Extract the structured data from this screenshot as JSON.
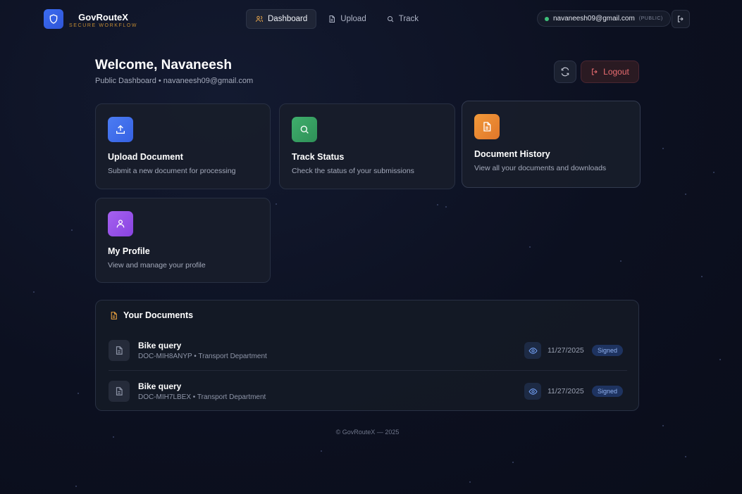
{
  "brand": {
    "name": "GovRouteX",
    "tagline": "SECURE WORKFLOW"
  },
  "nav": {
    "tabs": [
      {
        "label": "Dashboard",
        "icon": "users-icon",
        "active": true
      },
      {
        "label": "Upload",
        "icon": "file-icon",
        "active": false
      },
      {
        "label": "Track",
        "icon": "search-icon",
        "active": false
      }
    ],
    "user_email": "navaneesh09@gmail.com",
    "user_role": "(PUBLIC)"
  },
  "header": {
    "welcome": "Welcome, Navaneesh",
    "subtitle": "Public Dashboard • navaneesh09@gmail.com",
    "logout_label": "Logout"
  },
  "cards": [
    {
      "title": "Upload Document",
      "description": "Submit a new document for processing",
      "icon": "upload-icon",
      "color": "#4c7cf3"
    },
    {
      "title": "Track Status",
      "description": "Check the status of your submissions",
      "icon": "search-icon",
      "color": "#3fae6c"
    },
    {
      "title": "Document History",
      "description": "View all your documents and downloads",
      "icon": "document-icon",
      "color": "#f29a3a"
    },
    {
      "title": "My Profile",
      "description": "View and manage your profile",
      "icon": "user-icon",
      "color": "#a661f0"
    }
  ],
  "documents": {
    "title": "Your Documents",
    "items": [
      {
        "name": "Bike query",
        "meta": "DOC-MIH8ANYP • Transport Department",
        "date": "11/27/2025",
        "status": "Signed"
      },
      {
        "name": "Bike query",
        "meta": "DOC-MIH7LBEX • Transport Department",
        "date": "11/27/2025",
        "status": "Signed"
      }
    ]
  },
  "footer": {
    "text": "© GovRouteX — 2025"
  },
  "colors": {
    "accent": "#3b6cf0",
    "logout": "#e86c70",
    "signed_badge": "#1e3360",
    "brand_tag": "#c08a32"
  }
}
